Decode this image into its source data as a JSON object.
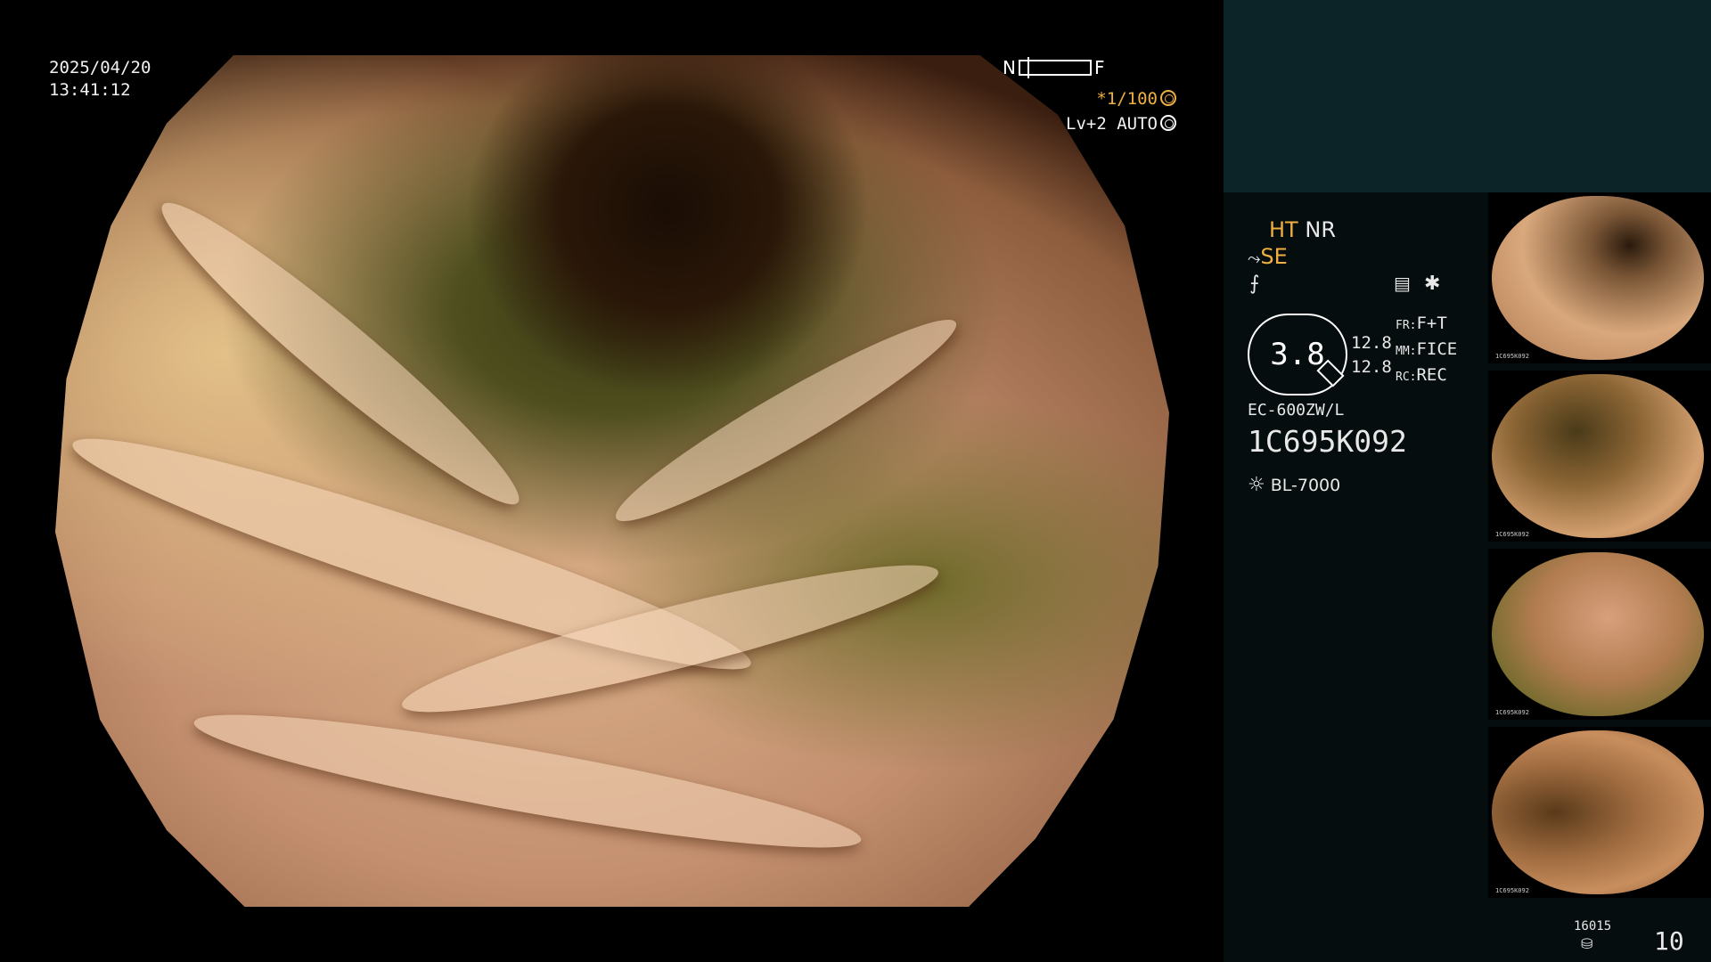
{
  "osd": {
    "date": "2025/04/20",
    "time": "13:41:12",
    "near_label": "N",
    "far_label": "F",
    "shutter": "*1/100",
    "level": "Lv+2 AUTO"
  },
  "panel": {
    "ht": "HT",
    "nr": "NR",
    "se": "SE",
    "zoom_value": "3.8",
    "fr_label": "FR:",
    "fr_value": "F+T",
    "mm_label": "MM:",
    "mm_value": "FICE",
    "rc_label": "RC:",
    "rc_value": "REC",
    "val_1": "12.8",
    "val_2": "12.8",
    "scope_model": "EC-600ZW/L",
    "serial": "1C695K092",
    "light_source": "BL-7000",
    "storage_count": "16015",
    "image_count": "10"
  },
  "thumbnails": [
    {
      "caption": "1C695K092",
      "tone": "#c9946c"
    },
    {
      "caption": "1C695K092",
      "tone": "#b98458"
    },
    {
      "caption": "1C695K092",
      "tone": "#c4906a"
    },
    {
      "caption": "1C695K092",
      "tone": "#b57a4a"
    }
  ],
  "colors": {
    "accent": "#f0b040",
    "panel_top": "#0c2427",
    "panel_bg": "#060d0e"
  },
  "icons": [
    "freeze-icon",
    "auto-iris-icon",
    "structure-enhance-icon",
    "filter-icon",
    "settings-card-icon",
    "asterisk-icon",
    "zoom-icon",
    "light-source-icon",
    "storage-icon"
  ]
}
